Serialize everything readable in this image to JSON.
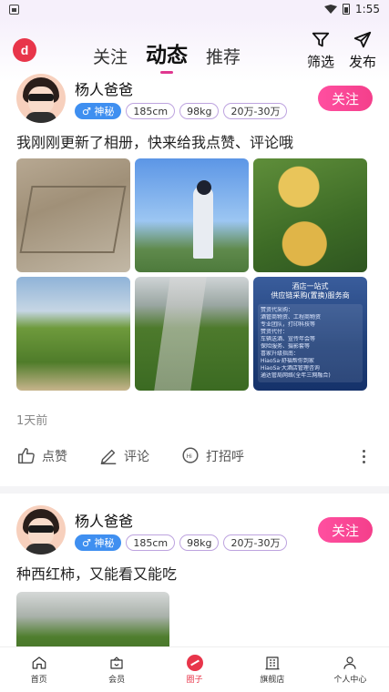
{
  "statusbar": {
    "time": "1:55"
  },
  "topnav": {
    "logo_letter": "d",
    "tabs": [
      {
        "label": "关注",
        "active": false
      },
      {
        "label": "动态",
        "active": true
      },
      {
        "label": "推荐",
        "active": false
      }
    ],
    "filter_label": "筛选",
    "publish_label": "发布"
  },
  "posts": [
    {
      "user_name": "杨人爸爸",
      "gender_tag": "♂ 神秘",
      "height": "185cm",
      "weight": "98kg",
      "income": "20万-30万",
      "follow_label": "关注",
      "text": "我刚刚更新了相册，快来给我点赞、评论哦",
      "poster": {
        "title": "酒店一站式",
        "subtitle": "供应链采购(置换)服务商",
        "lines": [
          "赞资代采购：",
          "酒管商物资、工程商物资",
          "专业团队，打印科技等",
          "赞资代付：",
          "车辆送酒、宣传年会等",
          "保险服务、摄影套等",
          "喜家升级指南：",
          "HiaoSa·舒福帮你到家",
          "HiaoSa·大酒店管理咨询",
          "通达管局网络(全年三网融合)"
        ]
      },
      "time": "1天前",
      "actions": {
        "like": "点赞",
        "comment": "评论",
        "greet": "打招呼"
      }
    },
    {
      "user_name": "杨人爸爸",
      "gender_tag": "♂ 神秘",
      "height": "185cm",
      "weight": "98kg",
      "income": "20万-30万",
      "follow_label": "关注",
      "text": "种西红柿，又能看又能吃"
    }
  ],
  "tabbar": [
    {
      "label": "首页",
      "icon": "home-icon"
    },
    {
      "label": "会员",
      "icon": "member-icon"
    },
    {
      "label": "圈子",
      "icon": "circle-icon",
      "active": true
    },
    {
      "label": "旗舰店",
      "icon": "store-icon"
    },
    {
      "label": "个人中心",
      "icon": "profile-icon"
    }
  ],
  "colors": {
    "accent": "#e8354a",
    "follow": "#f43f8b",
    "tab_underline": "#e0378f",
    "gender_tag": "#3f8ff0"
  }
}
